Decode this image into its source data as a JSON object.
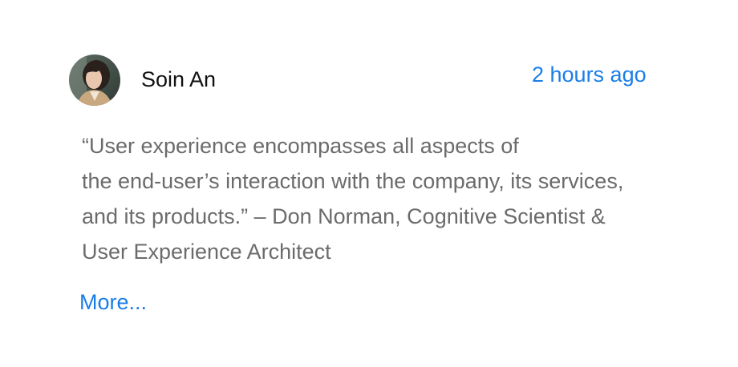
{
  "post": {
    "author": "Soin An",
    "timestamp": "2 hours ago",
    "quote_lines": [
      "“User experience encompasses all aspects of",
      "the end-user’s interaction with the company, its services,",
      "and its products.” – Don Norman, Cognitive Scientist &",
      "User Experience Architect"
    ],
    "more_label": "More..."
  },
  "colors": {
    "link": "#1a7ee8",
    "author": "#111111",
    "body_text": "#6b6b6b"
  }
}
